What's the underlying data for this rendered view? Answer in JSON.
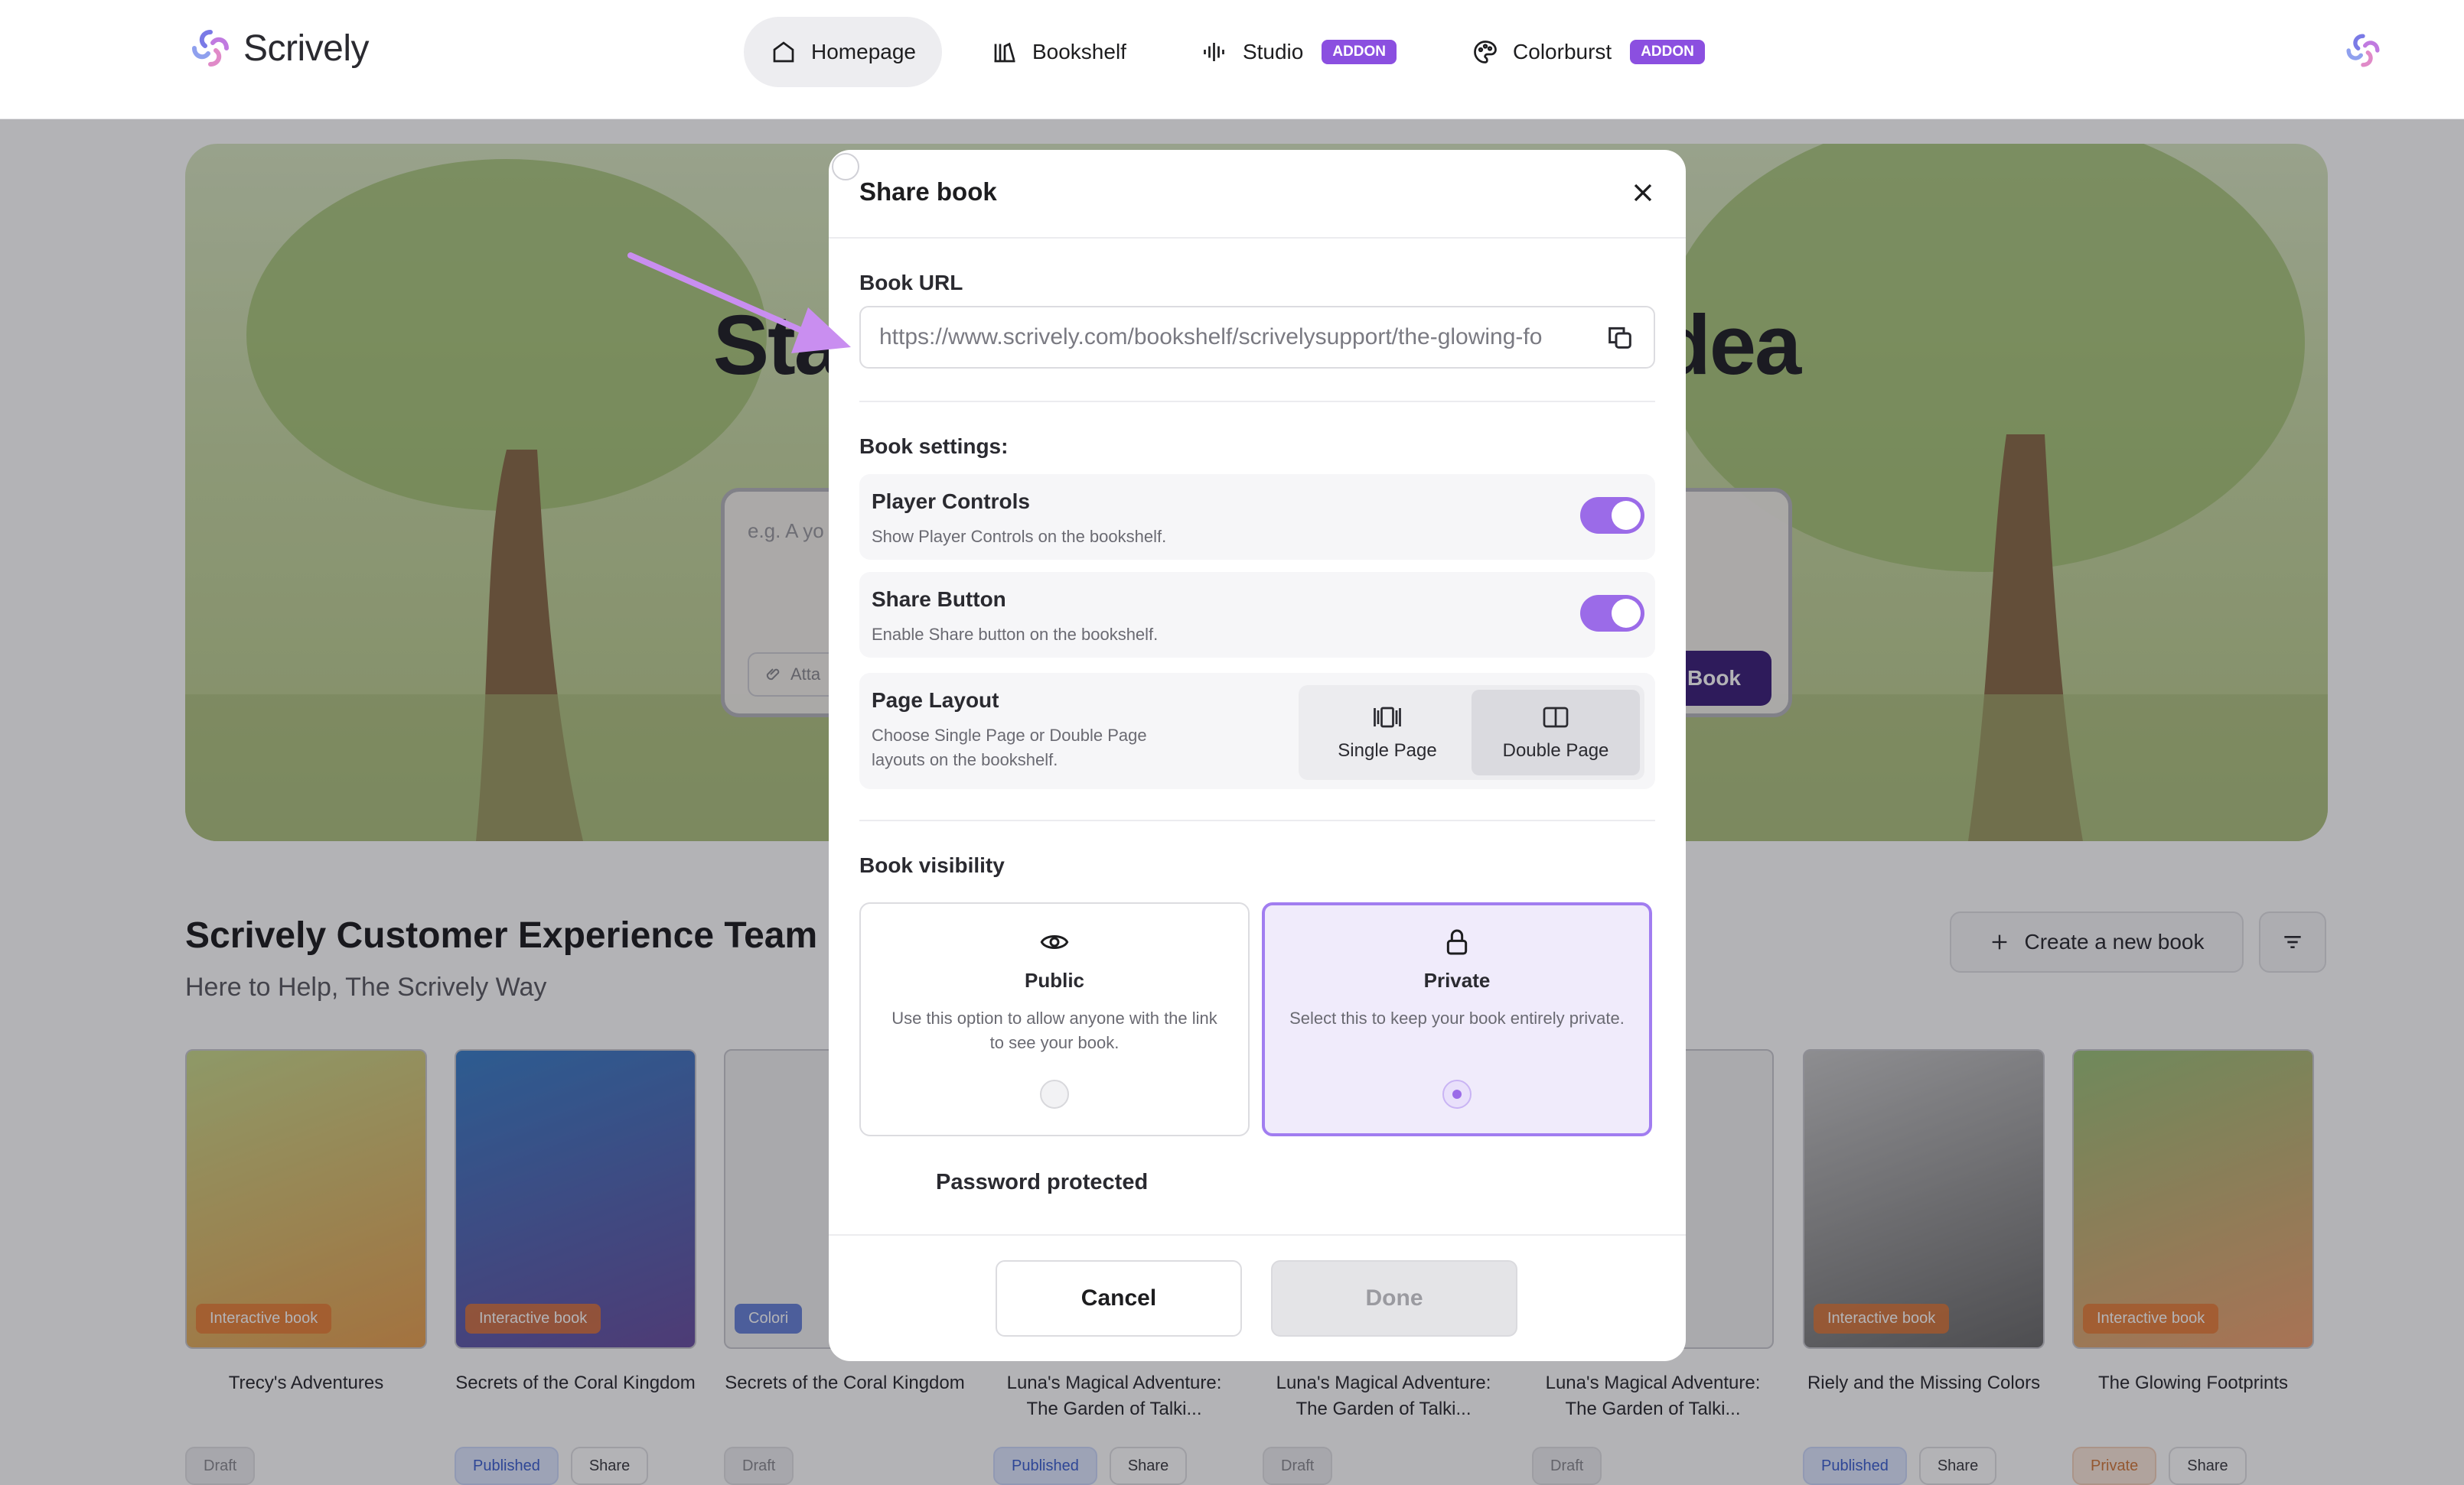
{
  "app": {
    "name": "Scrively"
  },
  "nav": {
    "items": [
      {
        "label": "Homepage",
        "icon": "home-icon",
        "active": true
      },
      {
        "label": "Bookshelf",
        "icon": "bookshelf-icon"
      },
      {
        "label": "Studio",
        "icon": "audio-wave-icon",
        "badge": "ADDON"
      },
      {
        "label": "Colorburst",
        "icon": "palette-icon",
        "badge": "ADDON"
      }
    ]
  },
  "hero": {
    "title_left": "Start",
    "title_right": "e idea",
    "placeholder": "e.g. A yo",
    "attach_label": "Atta",
    "create_label": "Book"
  },
  "team": {
    "name": "Scrively Customer Experience Team",
    "tagline": "Here to Help, The Scrively Way",
    "new_book_label": "Create a new book"
  },
  "books": [
    {
      "title": "Trecy's Adventures",
      "label": "Interactive book",
      "status": [
        "Draft"
      ]
    },
    {
      "title": "Secrets of the Coral Kingdom",
      "label": "Interactive book",
      "status": [
        "Published",
        "Share"
      ]
    },
    {
      "title": "Secrets of the Coral Kingdom",
      "label": "Colori",
      "status": [
        "Draft"
      ]
    },
    {
      "title": "Luna's Magical Adventure: The Garden of Talki...",
      "label": "",
      "status": [
        "Published",
        "Share"
      ]
    },
    {
      "title": "Luna's Magical Adventure: The Garden of Talki...",
      "label": "",
      "status": [
        "Draft"
      ]
    },
    {
      "title": "Luna's Magical Adventure: The Garden of Talki...",
      "label": "",
      "status": [
        "Draft"
      ]
    },
    {
      "title": "Riely and the Missing Colors",
      "label": "Interactive book",
      "status": [
        "Published",
        "Share"
      ]
    },
    {
      "title": "The Glowing Footprints",
      "label": "Interactive book",
      "status": [
        "Private",
        "Share"
      ]
    }
  ],
  "modal": {
    "title": "Share book",
    "book_url_label": "Book URL",
    "book_url": "https://www.scrively.com/bookshelf/scrivelysupport/the-glowing-fo",
    "settings_label": "Book settings:",
    "settings": [
      {
        "title": "Player Controls",
        "desc": "Show Player Controls on the bookshelf.",
        "on": true
      },
      {
        "title": "Share Button",
        "desc": "Enable Share button on the bookshelf.",
        "on": true
      }
    ],
    "page_layout": {
      "title": "Page Layout",
      "desc": "Choose Single Page or Double Page layouts on the bookshelf.",
      "options": [
        "Single Page",
        "Double Page"
      ],
      "selected": "Double Page"
    },
    "visibility_label": "Book visibility",
    "visibility": [
      {
        "title": "Public",
        "desc": "Use this option to allow anyone with the link to see your book.",
        "icon": "eye-icon"
      },
      {
        "title": "Private",
        "desc": "Select this to keep your book entirely private.",
        "icon": "lock-icon"
      }
    ],
    "selected_visibility": "Private",
    "password_label": "Password protected",
    "password_on": false,
    "cancel_label": "Cancel",
    "done_label": "Done"
  },
  "colors": {
    "accent": "#9b6be8",
    "addon": "#8b4fe0",
    "overlay": "rgba(20,20,28,0.32)"
  }
}
